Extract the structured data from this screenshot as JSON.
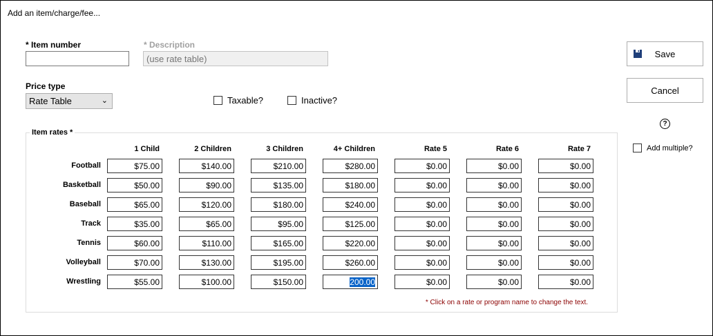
{
  "window": {
    "title": "Add an item/charge/fee..."
  },
  "form": {
    "item_number_label": "* Item number",
    "item_number_value": "",
    "description_label": "* Description",
    "description_placeholder": "(use rate table)",
    "price_type_label": "Price type",
    "price_type_value": "Rate Table",
    "taxable_label": "Taxable?",
    "inactive_label": "Inactive?"
  },
  "buttons": {
    "save_label": "Save",
    "cancel_label": "Cancel",
    "help_label": "?",
    "add_multiple_label": "Add multiple?"
  },
  "rates": {
    "group_title": "Item rates *",
    "columns": [
      "1 Child",
      "2 Children",
      "3 Children",
      "4+ Children",
      "Rate 5",
      "Rate 6",
      "Rate 7"
    ],
    "rows": [
      {
        "name": "Football",
        "values": [
          "$75.00",
          "$140.00",
          "$210.00",
          "$280.00",
          "$0.00",
          "$0.00",
          "$0.00"
        ]
      },
      {
        "name": "Basketball",
        "values": [
          "$50.00",
          "$90.00",
          "$135.00",
          "$180.00",
          "$0.00",
          "$0.00",
          "$0.00"
        ]
      },
      {
        "name": "Baseball",
        "values": [
          "$65.00",
          "$120.00",
          "$180.00",
          "$240.00",
          "$0.00",
          "$0.00",
          "$0.00"
        ]
      },
      {
        "name": "Track",
        "values": [
          "$35.00",
          "$65.00",
          "$95.00",
          "$125.00",
          "$0.00",
          "$0.00",
          "$0.00"
        ]
      },
      {
        "name": "Tennis",
        "values": [
          "$60.00",
          "$110.00",
          "$165.00",
          "$220.00",
          "$0.00",
          "$0.00",
          "$0.00"
        ]
      },
      {
        "name": "Volleyball",
        "values": [
          "$70.00",
          "$130.00",
          "$195.00",
          "$260.00",
          "$0.00",
          "$0.00",
          "$0.00"
        ]
      },
      {
        "name": "Wrestling",
        "values": [
          "$55.00",
          "$100.00",
          "$150.00",
          "200.00",
          "$0.00",
          "$0.00",
          "$0.00"
        ]
      }
    ],
    "note": "* Click on a rate or program name to change the text."
  },
  "colors": {
    "selection": "#0a64c8",
    "note": "#8b0000",
    "save_icon": "#1f3f7a"
  }
}
